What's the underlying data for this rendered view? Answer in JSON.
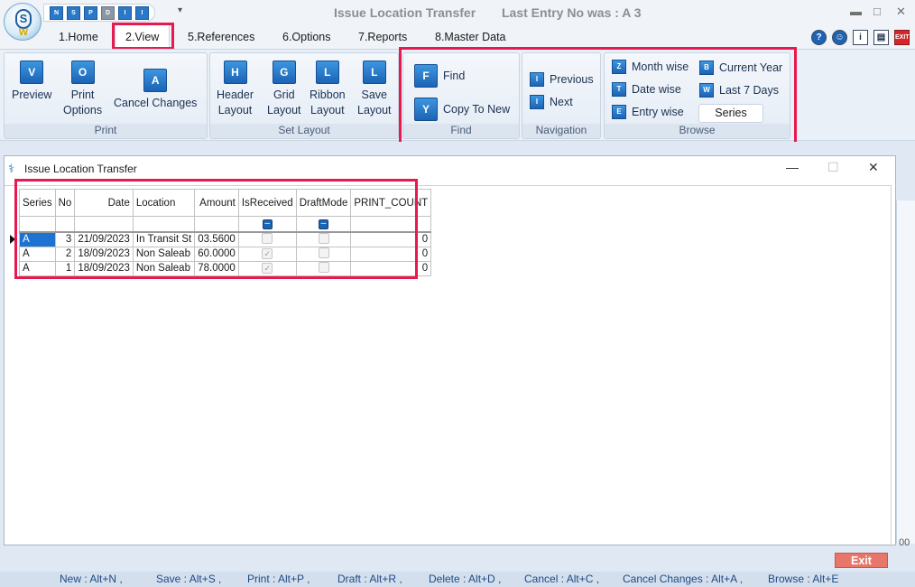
{
  "window": {
    "title": "Issue Location Transfer",
    "last_entry": "Last Entry No was : A 3",
    "minimize": "▬",
    "maximize": "□",
    "close": "✕"
  },
  "quick_access": [
    "N",
    "S",
    "P",
    "D",
    "I",
    "I"
  ],
  "tabs": [
    {
      "label": "1.Home"
    },
    {
      "label": "2.View"
    },
    {
      "label": "5.References"
    },
    {
      "label": "6.Options"
    },
    {
      "label": "7.Reports"
    },
    {
      "label": "8.Master Data"
    }
  ],
  "topright": [
    "?",
    "☺",
    "i",
    "▤",
    "EXIT"
  ],
  "ribbon": {
    "print": {
      "label": "Print",
      "preview": "Preview",
      "preview_icon": "V",
      "print_options_1": "Print",
      "print_options_2": "Options",
      "print_options_icon": "O",
      "cancel_changes": "Cancel Changes",
      "cancel_icon": "A"
    },
    "set_layout": {
      "label": "Set Layout",
      "header_1": "Header",
      "header_2": "Layout",
      "header_icon": "H",
      "grid_1": "Grid",
      "grid_2": "Layout",
      "grid_icon": "G",
      "ribbon_1": "Ribbon",
      "ribbon_2": "Layout",
      "ribbon_icon": "L",
      "save_1": "Save",
      "save_2": "Layout",
      "save_icon": "L"
    },
    "find": {
      "label": "Find",
      "find": "Find",
      "find_icon": "F",
      "copy_to_new": "Copy To New",
      "copy_icon": "Y"
    },
    "navigation": {
      "label": "Navigation",
      "previous": "Previous",
      "previous_icon": "I",
      "next": "Next",
      "next_icon": "I"
    },
    "browse": {
      "label": "Browse",
      "month_wise": "Month wise",
      "month_icon": "Z",
      "date_wise": "Date wise",
      "date_icon": "T",
      "entry_wise": "Entry wise",
      "entry_icon": "E",
      "current_year": "Current Year",
      "current_icon": "B",
      "last_7_days": "Last 7 Days",
      "last7_icon": "W",
      "series": "Series"
    }
  },
  "child_window": {
    "title": "Issue Location Transfer",
    "minimize": "—",
    "maximize": "☐",
    "close": "✕"
  },
  "grid": {
    "columns": [
      "Series",
      "No",
      "Date",
      "Location",
      "Amount",
      "IsReceived",
      "DraftMode",
      "PRINT_COUNT"
    ],
    "rows": [
      {
        "series": "A",
        "no": "3",
        "date": "21/09/2023",
        "location": "In Transit St",
        "amount": "03.5600",
        "is_received": false,
        "draft_mode": false,
        "print_count": "0"
      },
      {
        "series": "A",
        "no": "2",
        "date": "18/09/2023",
        "location": "Non Saleab",
        "amount": "60.0000",
        "is_received": true,
        "draft_mode": false,
        "print_count": "0"
      },
      {
        "series": "A",
        "no": "1",
        "date": "18/09/2023",
        "location": "Non Saleab",
        "amount": "78.0000",
        "is_received": true,
        "draft_mode": false,
        "print_count": "0"
      }
    ]
  },
  "exit_label": "Exit",
  "right_stub_text": "00",
  "shortcuts": [
    "New : Alt+N ,",
    "Save : Alt+S ,",
    "Print : Alt+P ,",
    "Draft : Alt+R ,",
    "Delete : Alt+D ,",
    "Cancel : Alt+C ,",
    "Cancel Changes : Alt+A ,",
    "Browse : Alt+E"
  ],
  "colors": {
    "highlight": "#e8194f",
    "accent": "#1e63b4",
    "exit_button": "#e8776a",
    "statusbar_text": "#1e4a86"
  }
}
